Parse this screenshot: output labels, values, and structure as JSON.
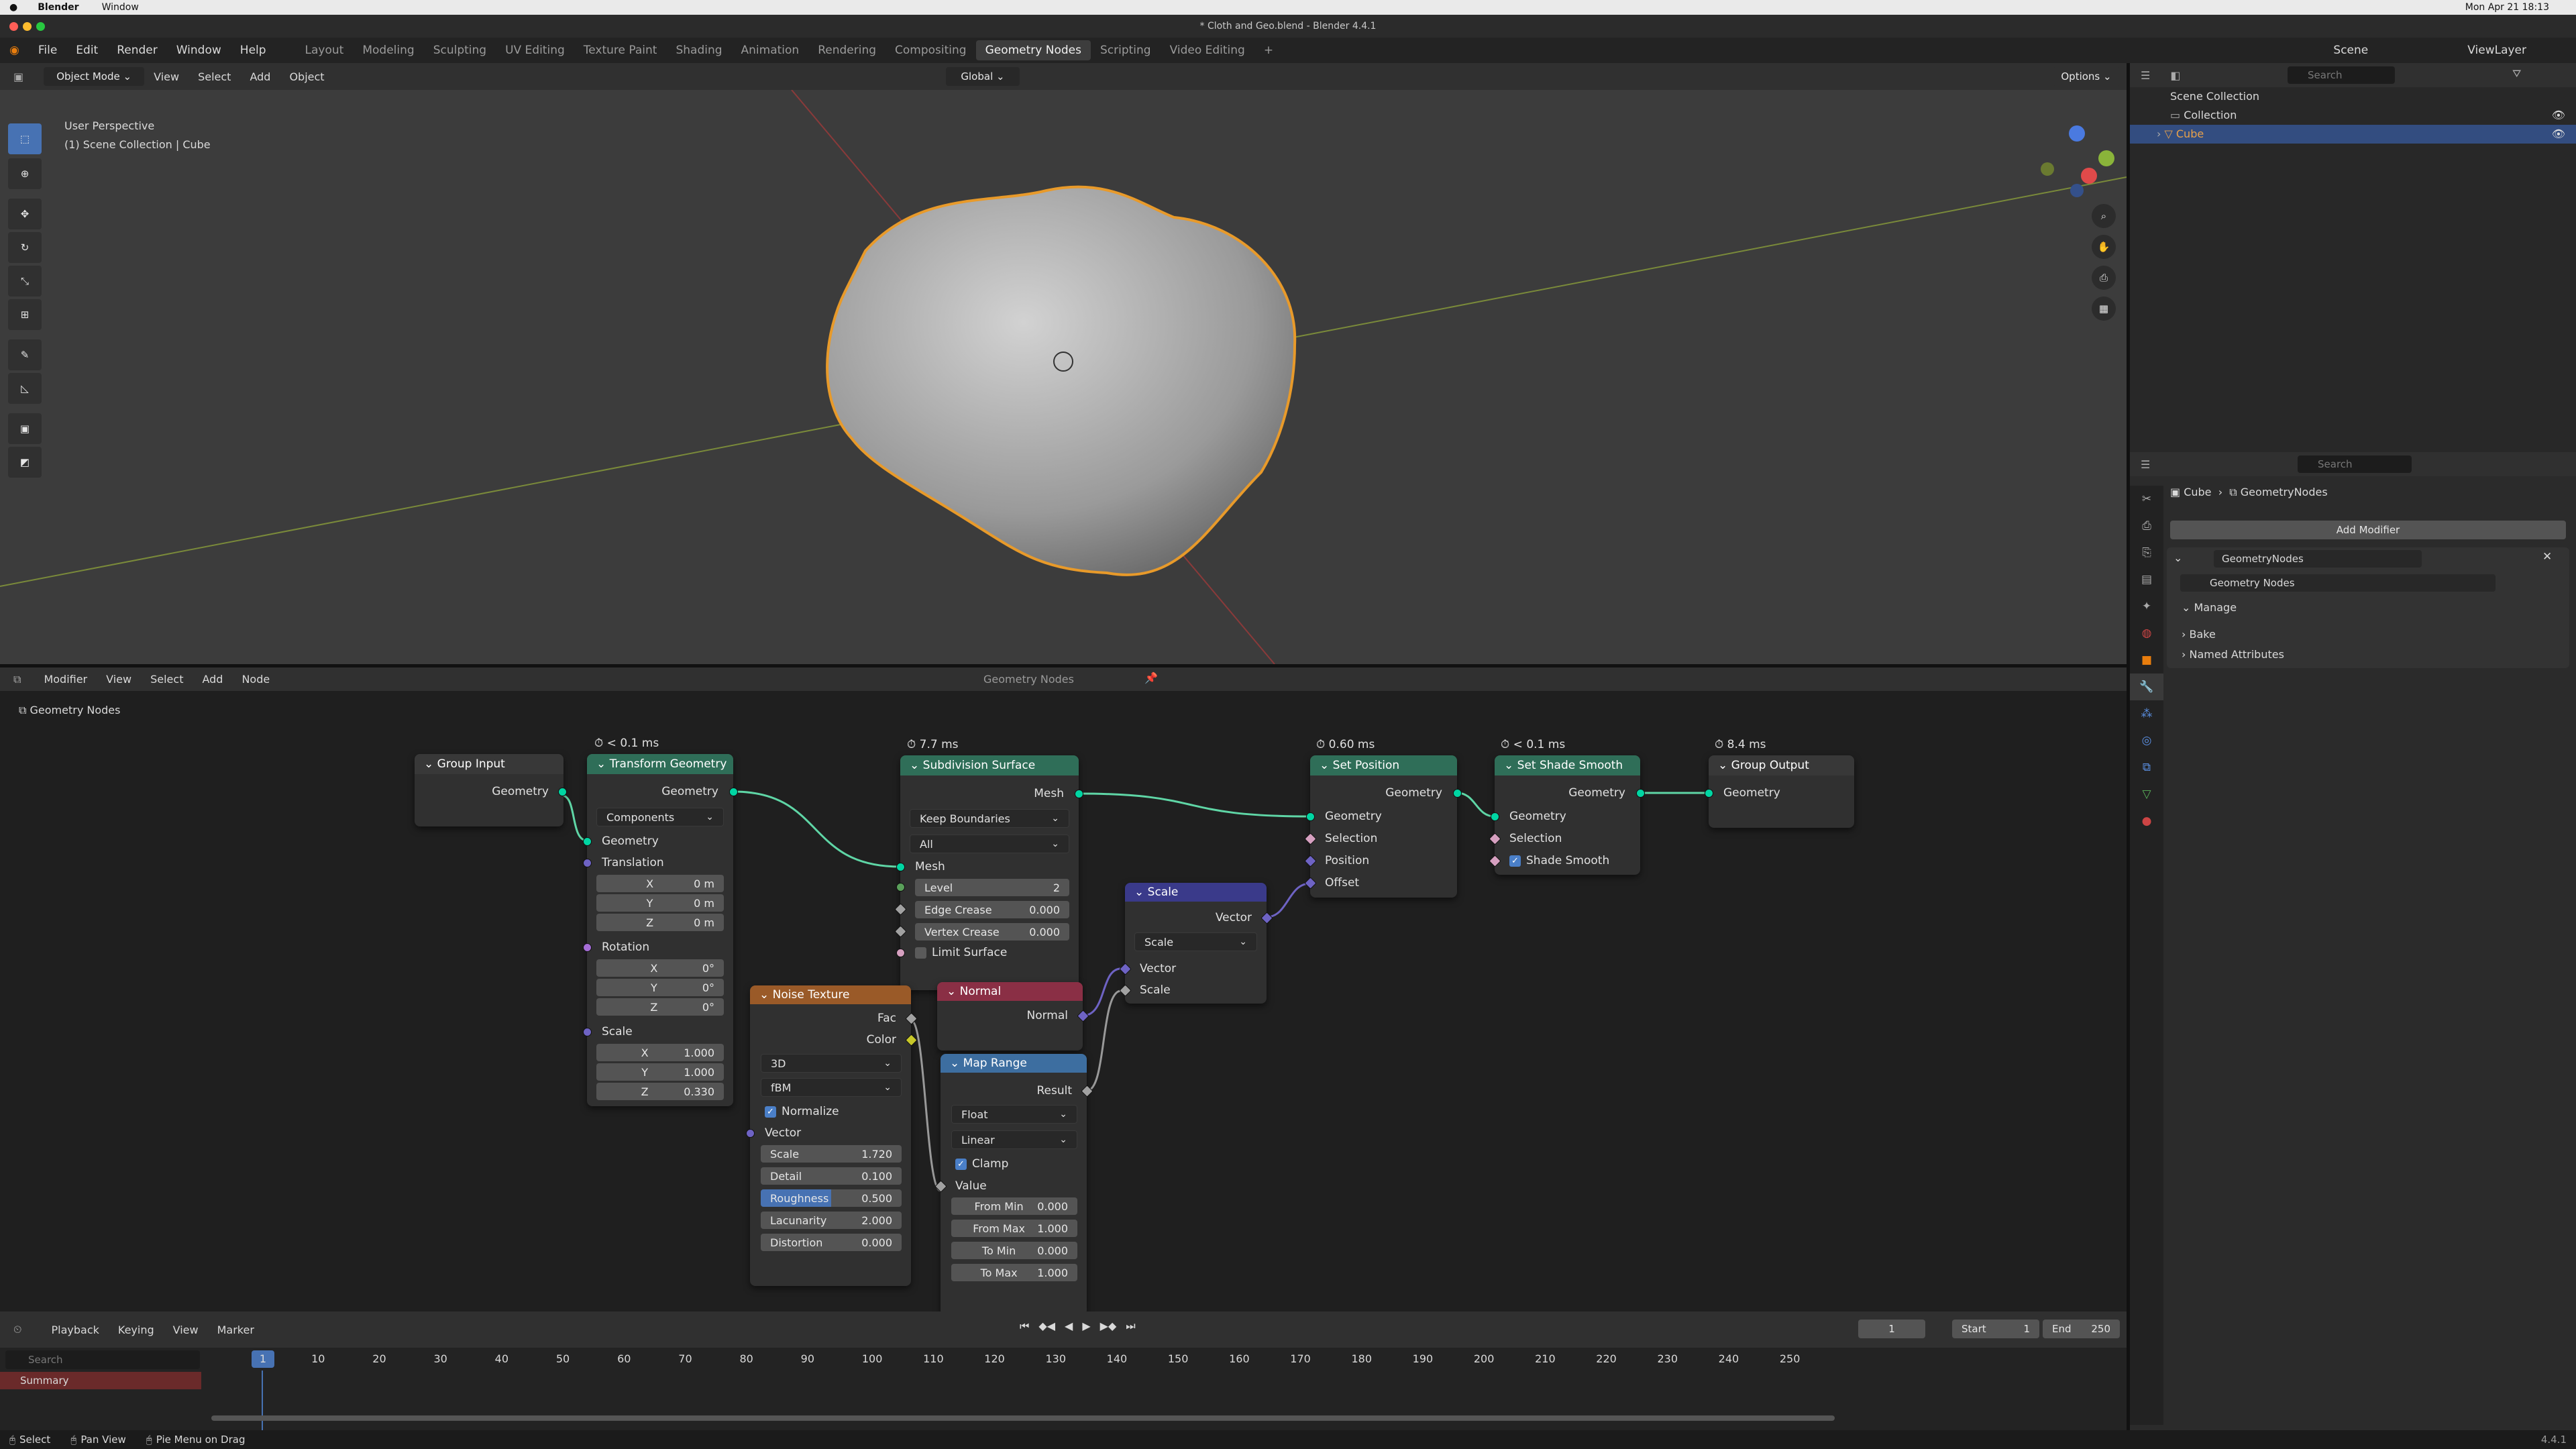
{
  "macbar": {
    "apple": "",
    "app": "Blender",
    "window": "Window",
    "datetime": "Mon Apr 21 18:13"
  },
  "titlebar": {
    "title": "* Cloth and Geo.blend - Blender 4.4.1"
  },
  "menu": {
    "items": [
      "File",
      "Edit",
      "Render",
      "Window",
      "Help"
    ]
  },
  "workspaces": [
    "Layout",
    "Modeling",
    "Sculpting",
    "UV Editing",
    "Texture Paint",
    "Shading",
    "Animation",
    "Rendering",
    "Compositing",
    "Geometry Nodes",
    "Scripting",
    "Video Editing"
  ],
  "scene": {
    "scene_label": "Scene",
    "viewlayer_label": "ViewLayer"
  },
  "viewport_header": {
    "mode": "Object Mode",
    "menus": [
      "View",
      "Select",
      "Add",
      "Object"
    ],
    "transform": "Global",
    "options": "Options",
    "search_placeholder": "Search"
  },
  "viewport": {
    "perspective": "User Perspective",
    "collection": "(1) Scene Collection | Cube"
  },
  "node_header": {
    "editor": "Modifier",
    "menus": [
      "View",
      "Select",
      "Add",
      "Node"
    ],
    "tree_name": "Geometry Nodes",
    "breadcrumb": "Geometry Nodes"
  },
  "nodes": {
    "group_input": {
      "title": "Group Input",
      "out_geometry": "Geometry"
    },
    "transform": {
      "title": "Transform Geometry",
      "timing": "< 0.1 ms",
      "out_geometry": "Geometry",
      "mode": "Components",
      "in_geometry": "Geometry",
      "translation": "Translation",
      "tx": "0 m",
      "ty": "0 m",
      "tz": "0 m",
      "rotation": "Rotation",
      "rx": "0°",
      "ry": "0°",
      "rz": "0°",
      "scale": "Scale",
      "sx": "1.000",
      "sy": "1.000",
      "sz": "0.330",
      "X": "X",
      "Y": "Y",
      "Z": "Z"
    },
    "subdiv": {
      "title": "Subdivision Surface",
      "timing": "7.7 ms",
      "out_mesh": "Mesh",
      "boundaries": "Keep Boundaries",
      "uv": "All",
      "in_mesh": "Mesh",
      "level_label": "Level",
      "level": "2",
      "edge_label": "Edge Crease",
      "edge": "0.000",
      "vertex_label": "Vertex Crease",
      "vertex": "0.000",
      "limit": "Limit Surface"
    },
    "set_position": {
      "title": "Set Position",
      "timing": "0.60 ms",
      "out_geometry": "Geometry",
      "geometry": "Geometry",
      "selection": "Selection",
      "position": "Position",
      "offset": "Offset"
    },
    "set_smooth": {
      "title": "Set Shade Smooth",
      "timing": "< 0.1 ms",
      "out_geometry": "Geometry",
      "geometry": "Geometry",
      "selection": "Selection",
      "smooth": "Shade Smooth"
    },
    "group_output": {
      "title": "Group Output",
      "timing": "8.4 ms",
      "geometry": "Geometry"
    },
    "scale": {
      "title": "Scale",
      "out_vector": "Vector",
      "op": "Scale",
      "vector": "Vector",
      "scale": "Scale"
    },
    "normal": {
      "title": "Normal",
      "out_normal": "Normal"
    },
    "noise": {
      "title": "Noise Texture",
      "fac": "Fac",
      "color": "Color",
      "dims": "3D",
      "type": "fBM",
      "normalize": "Normalize",
      "vector": "Vector",
      "scale_label": "Scale",
      "scale": "1.720",
      "detail_label": "Detail",
      "detail": "0.100",
      "rough_label": "Roughness",
      "rough": "0.500",
      "lac_label": "Lacunarity",
      "lac": "2.000",
      "dist_label": "Distortion",
      "dist": "0.000"
    },
    "map_range": {
      "title": "Map Range",
      "result": "Result",
      "dtype": "Float",
      "interp": "Linear",
      "clamp": "Clamp",
      "value": "Value",
      "fmin_label": "From Min",
      "fmin": "0.000",
      "fmax_label": "From Max",
      "fmax": "1.000",
      "tmin_label": "To Min",
      "tmin": "0.000",
      "tmax_label": "To Max",
      "tmax": "1.000"
    }
  },
  "timeline": {
    "menus": [
      "Playback",
      "Keying",
      "View",
      "Marker"
    ],
    "current": "1",
    "start_label": "Start",
    "start": "1",
    "end_label": "End",
    "end": "250",
    "summary": "Summary",
    "search_placeholder": "Search",
    "ticks": [
      "10",
      "20",
      "30",
      "40",
      "50",
      "60",
      "70",
      "80",
      "90",
      "100",
      "110",
      "120",
      "130",
      "140",
      "150",
      "160",
      "170",
      "180",
      "190",
      "200",
      "210",
      "220",
      "230",
      "240",
      "250"
    ]
  },
  "status": {
    "select": "Select",
    "pan": "Pan View",
    "pie": "Pie Menu on Drag",
    "version": "4.4.1"
  },
  "outliner": {
    "search_placeholder": "Search",
    "scene_collection": "Scene Collection",
    "collection": "Collection",
    "cube": "Cube"
  },
  "properties": {
    "search_placeholder": "Search",
    "object": "Cube",
    "modifier_path": "GeometryNodes",
    "add_modifier": "Add Modifier",
    "modifier_name": "GeometryNodes",
    "tree": "Geometry Nodes",
    "manage": "Manage",
    "bake": "Bake",
    "named_attrs": "Named Attributes"
  }
}
